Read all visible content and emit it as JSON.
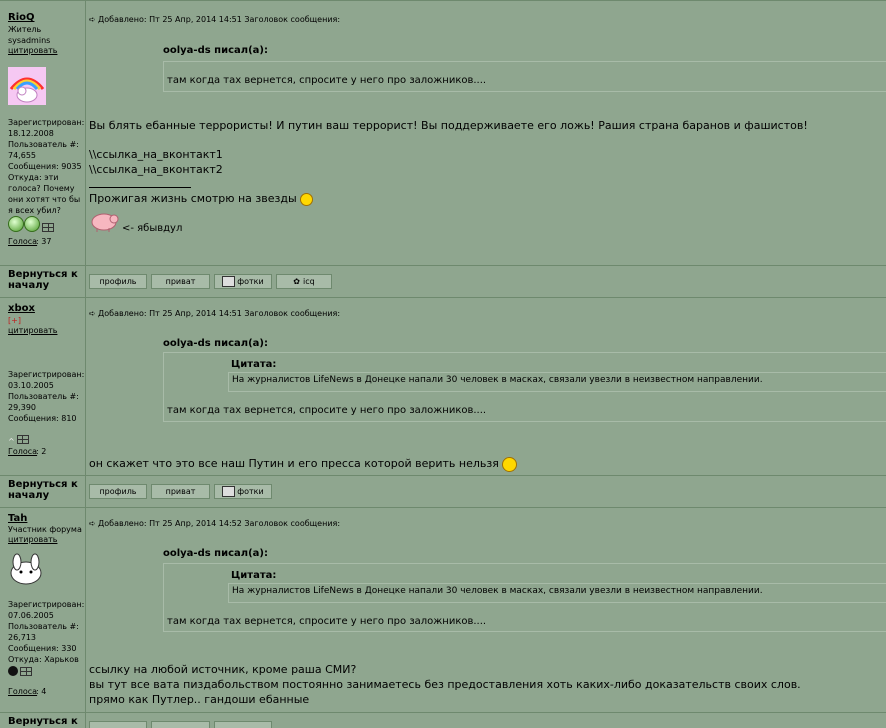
{
  "posts": [
    {
      "author": "RioQ",
      "title": "Житель sysadmins",
      "quote_link": "цитировать",
      "stats": {
        "registered_label": "Зарегистрирован:",
        "registered": "18.12.2008",
        "user_num_label": "Пользователь #:",
        "user_num": "74,655",
        "messages_label": "Сообщения:",
        "messages": "9035",
        "from_label": "Откуда:",
        "from": "эти голоса? Почему они хотят что бы я всех убил?"
      },
      "votes_label": "Голоса",
      "votes": ": 37",
      "header": "Добавлено: Пт 25 Апр, 2014 14:51     Заголовок сообщения:",
      "quote_author": "oolya-ds писал(а):",
      "quote_text": "там когда тах вернется, спросите у него про заложников....",
      "body": [
        "Вы блять ебанные террористы! И путин ваш террорист! Вы поддерживаете его ложь! Рашия страна баранов и фашистов!",
        "\\\\ссылка_на_вконтакт1",
        "\\\\ссылка_на_вконтакт2"
      ],
      "signature": "Прожигая жизнь смотрю на звезды",
      "signature2": "<- ябывдул",
      "back": "Вернуться к началу",
      "buttons": [
        "профиль",
        "приват",
        "фотки",
        "icq"
      ]
    },
    {
      "author": "xbox",
      "title": "[+]",
      "quote_link": "цитировать",
      "stats": {
        "registered_label": "Зарегистрирован:",
        "registered": "03.10.2005",
        "user_num_label": "Пользователь #:",
        "user_num": "29,390",
        "messages_label": "Сообщения:",
        "messages": "810"
      },
      "votes_label": "Голоса",
      "votes": ": 2",
      "header": "Добавлено: Пт 25 Апр, 2014 14:51     Заголовок сообщения:",
      "quote_author": "oolya-ds писал(а):",
      "cite_label": "Цитата:",
      "cite_text": "На журналистов LifeNews в Донецке напали 30 человек в масках, связали увезли в неизвестном направлении.",
      "quote_text": "там когда тах вернется, спросите у него про заложников....",
      "body": [
        "он скажет что это все наш Путин и его пресса которой верить нельзя"
      ],
      "back": "Вернуться к началу",
      "buttons": [
        "профиль",
        "приват",
        "фотки"
      ]
    },
    {
      "author": "Tah",
      "title": "Участник форума",
      "quote_link": "цитировать",
      "stats": {
        "registered_label": "Зарегистрирован:",
        "registered": "07.06.2005",
        "user_num_label": "Пользователь #:",
        "user_num": "26,713",
        "messages_label": "Сообщения:",
        "messages": "330",
        "from_label": "Откуда:",
        "from": "Харьков"
      },
      "votes_label": "Голоса",
      "votes": ": 4",
      "header": "Добавлено: Пт 25 Апр, 2014 14:52     Заголовок сообщения:",
      "quote_author": "oolya-ds писал(а):",
      "cite_label": "Цитата:",
      "cite_text": "На журналистов LifeNews в Донецке напали 30 человек в масках, связали увезли в неизвестном направлении.",
      "quote_text": "там когда тах вернется, спросите у него про заложников....",
      "body": [
        "ссылку на любой источник, кроме раша СМИ?",
        "вы тут все вата пиздабольством постоянно занимаетесь без предоставления хоть каких-либо доказательств своих слов.",
        "прямо как Путлер.. гандоши ебанные"
      ],
      "back": "Вернуться к началу"
    }
  ]
}
